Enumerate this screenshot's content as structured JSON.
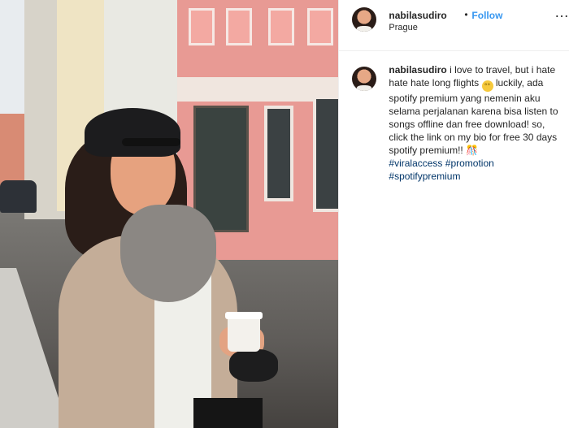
{
  "post": {
    "header": {
      "username": "nabilasudiro",
      "separator": "•",
      "follow_label": "Follow",
      "location": "Prague",
      "more_label": "…"
    },
    "caption": {
      "username": "nabilasudiro",
      "text_1": "i love to travel, but i hate hate hate long flights",
      "emoji_1": "°°",
      "text_2": "luckily, ada spotify premium yang nemenin aku selama perjalanan karena bisa listen to songs offline dan free download! so, click the link on my bio for free 30 days spotify premium!!",
      "emoji_2": "🎊",
      "hashtags": [
        "#viralaccess",
        "#promotion",
        "#spotifypremium"
      ]
    }
  },
  "colors": {
    "follow": "#3897f0",
    "hashtag": "#003569",
    "text": "#262626"
  }
}
